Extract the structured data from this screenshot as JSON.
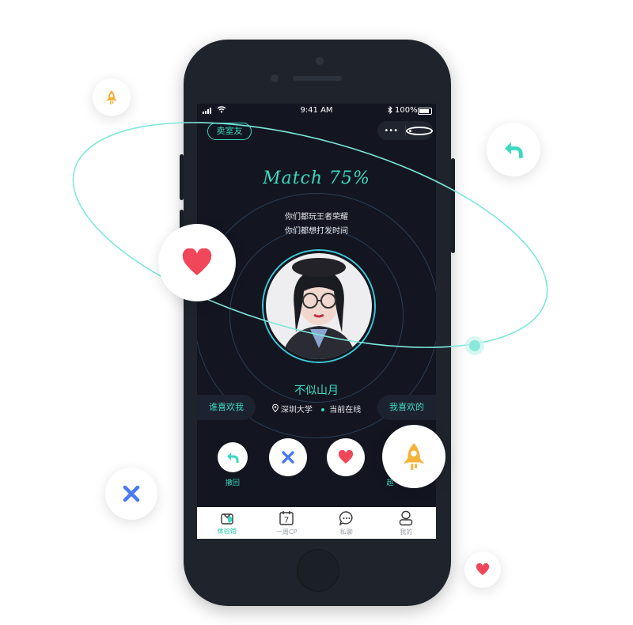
{
  "status_bar": {
    "time": "9:41 AM",
    "battery": "100%"
  },
  "header": {
    "tag_button": "卖室友",
    "menu_icon": "•••"
  },
  "match": {
    "title": "Match 75%"
  },
  "taglines": [
    "你们都玩王者荣耀",
    "你们都想打发时间"
  ],
  "profile": {
    "name": "不似山月",
    "school": "深圳大学",
    "online_status": "当前在线"
  },
  "side_buttons": {
    "left": "谁喜欢我",
    "right": "我喜欢的"
  },
  "actions": [
    {
      "icon": "undo-icon",
      "label": "撤回"
    },
    {
      "icon": "close-icon",
      "label": ""
    },
    {
      "icon": "heart-icon",
      "label": ""
    },
    {
      "icon": "rocket-icon",
      "label": "超"
    }
  ],
  "tabs": [
    {
      "icon": "gift-hall-icon",
      "label": "体验馆",
      "active": true
    },
    {
      "icon": "calendar-icon",
      "label": "一周CP",
      "calendar_day": "7",
      "active": false
    },
    {
      "icon": "chat-icon",
      "label": "私聊",
      "active": false
    },
    {
      "icon": "profile-icon",
      "label": "我的",
      "active": false
    }
  ],
  "colors": {
    "accent": "#3ad9c0",
    "screen_bg": "#131621",
    "heart": "#f0475a",
    "close": "#4a7af0",
    "rocket": "#f5b33a",
    "phone_body": "#1f242c"
  }
}
